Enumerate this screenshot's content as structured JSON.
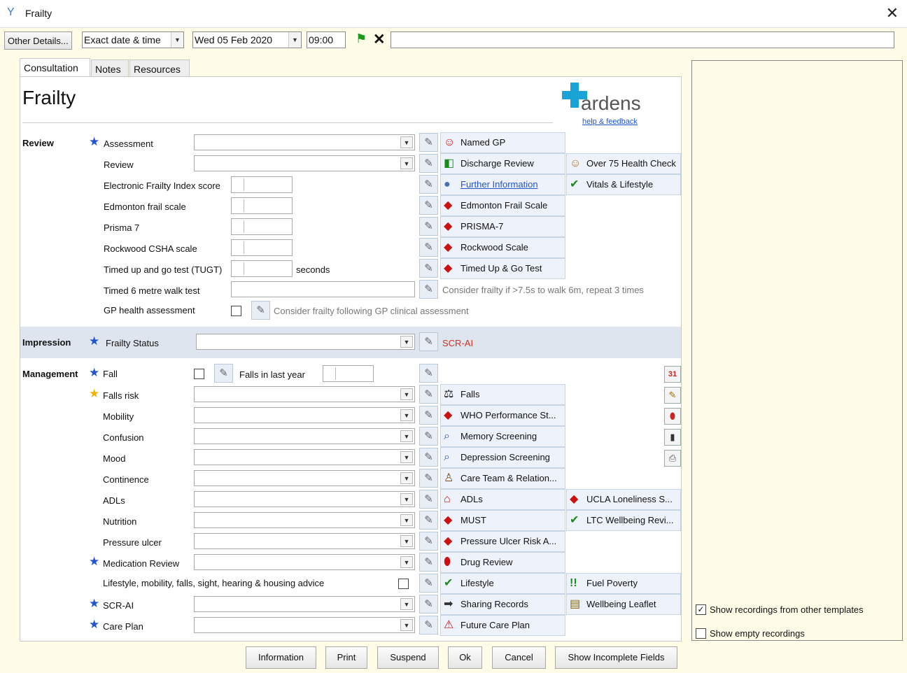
{
  "window": {
    "title": "Frailty"
  },
  "toolbar": {
    "other_details": "Other Details...",
    "date_mode": "Exact date & time",
    "date": "Wed 05 Feb 2020",
    "time": "09:00",
    "free_text": ""
  },
  "tabs": [
    "Consultation",
    "Notes",
    "Resources"
  ],
  "page": {
    "heading": "Frailty",
    "logo_text": "ardens",
    "help_link": "help & feedback"
  },
  "sections": {
    "review": "Review",
    "impression": "Impression",
    "management": "Management"
  },
  "review": {
    "assessment": "Assessment",
    "review": "Review",
    "efi": "Electronic Frailty Index score",
    "edmonton": "Edmonton frail scale",
    "prisma": "Prisma 7",
    "rockwood": "Rockwood CSHA scale",
    "tugt": "Timed up and go test (TUGT)",
    "tugt_unit": "seconds",
    "walk": "Timed 6 metre walk test",
    "gp_health": "GP health assessment",
    "walk_note": "Consider frailty if >7.5s to walk 6m, repeat 3 times",
    "gp_note": "Consider frailty following GP clinical assessment"
  },
  "impression": {
    "frailty_status": "Frailty Status",
    "scr_note": "SCR-AI"
  },
  "management": {
    "fall": "Fall",
    "falls_last_year": "Falls in last year",
    "falls_risk": "Falls risk",
    "mobility": "Mobility",
    "confusion": "Confusion",
    "mood": "Mood",
    "continence": "Continence",
    "adls": "ADLs",
    "nutrition": "Nutrition",
    "pressure_ulcer": "Pressure ulcer",
    "medication_review": "Medication Review",
    "lifestyle_advice": "Lifestyle, mobility, falls, sight, hearing & housing advice",
    "scr_ai": "SCR-AI",
    "care_plan": "Care Plan"
  },
  "links": {
    "named_gp": "Named GP",
    "discharge_review": "Discharge Review",
    "further_info": "Further Information",
    "edmonton_scale": "Edmonton Frail Scale",
    "prisma7": "PRISMA-7",
    "rockwood_scale": "Rockwood Scale",
    "tug_test": "Timed Up & Go Test",
    "over75": "Over 75 Health Check",
    "vitals": "Vitals & Lifestyle",
    "falls": "Falls",
    "who": "WHO Performance St...",
    "memory": "Memory Screening",
    "depression": "Depression Screening",
    "care_team": "Care Team & Relation...",
    "adls": "ADLs",
    "must": "MUST",
    "pressure_risk": "Pressure Ulcer Risk A...",
    "drug_review": "Drug Review",
    "lifestyle": "Lifestyle",
    "sharing": "Sharing Records",
    "future_care": "Future Care Plan",
    "ucla": "UCLA Loneliness S...",
    "ltc": "LTC Wellbeing Revi...",
    "fuel": "Fuel Poverty",
    "wellbeing": "Wellbeing Leaflet"
  },
  "side": {
    "show_other": "Show recordings from other templates",
    "show_other_checked": true,
    "show_empty": "Show empty recordings",
    "show_empty_checked": false
  },
  "buttons": {
    "information": "Information",
    "print": "Print",
    "suspend": "Suspend",
    "ok": "Ok",
    "cancel": "Cancel",
    "show_incomplete": "Show Incomplete Fields"
  }
}
